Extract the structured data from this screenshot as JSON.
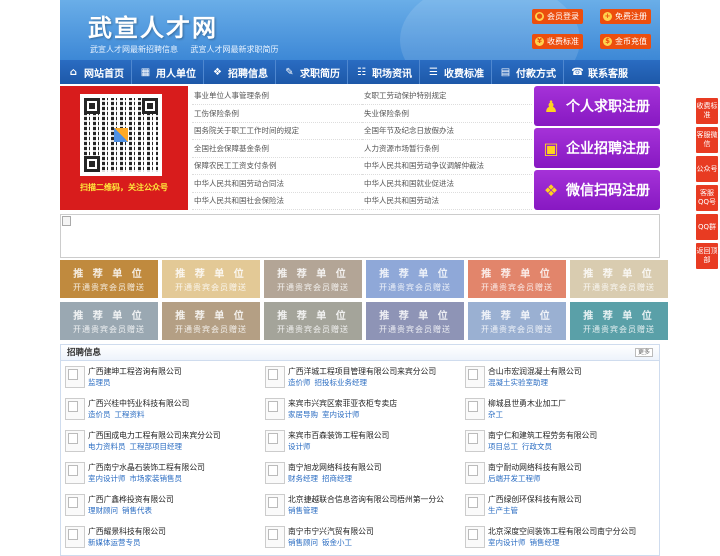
{
  "header": {
    "logo": "武宣人才网",
    "slogans": [
      "武宣人才网最新招聘信息",
      "武宣人才网最新求职简历"
    ],
    "buttons": [
      {
        "label": "会员登录",
        "icon": "user-icon"
      },
      {
        "label": "免费注册",
        "icon": "register-icon"
      },
      {
        "label": "收费标准",
        "icon": "price-icon"
      },
      {
        "label": "金币充值",
        "icon": "coin-icon"
      }
    ]
  },
  "nav": [
    {
      "label": "网站首页",
      "icon": "home-icon"
    },
    {
      "label": "用人单位",
      "icon": "building-icon"
    },
    {
      "label": "招聘信息",
      "icon": "megaphone-icon"
    },
    {
      "label": "求职简历",
      "icon": "resume-icon"
    },
    {
      "label": "职场资讯",
      "icon": "news-icon"
    },
    {
      "label": "收费标准",
      "icon": "price-icon"
    },
    {
      "label": "付款方式",
      "icon": "card-icon"
    },
    {
      "label": "联系客服",
      "icon": "phone-icon"
    }
  ],
  "qr": {
    "caption": "扫描二维码，关注公众号"
  },
  "laws": [
    [
      "事业单位人事管理条例",
      "女职工劳动保护特别规定"
    ],
    [
      "工伤保险条例",
      "失业保险条例"
    ],
    [
      "国务院关于职工工作时间的规定",
      "全国年节及纪念日放假办法"
    ],
    [
      "全国社会保障基金条例",
      "人力资源市场暂行条例"
    ],
    [
      "保障农民工工资支付条例",
      "中华人民共和国劳动争议调解仲裁法"
    ],
    [
      "中华人民共和国劳动合同法",
      "中华人民共和国就业促进法"
    ],
    [
      "中华人民共和国社会保险法",
      "中华人民共和国劳动法"
    ]
  ],
  "registers": [
    {
      "label": "个人求职注册",
      "icon": "person-icon"
    },
    {
      "label": "企业招聘注册",
      "icon": "company-icon"
    },
    {
      "label": "微信扫码注册",
      "icon": "wechat-icon"
    }
  ],
  "recommended": {
    "title": "推 荐 单 位",
    "subtitle": "开通贵宾会员赠送",
    "colors": [
      "#c08a3e",
      "#e3c996",
      "#b3a596",
      "#8fa8d8",
      "#e2856b",
      "#d9ccb0",
      "#9aa8b2",
      "#b49f84",
      "#a4a49a",
      "#8e94b6",
      "#9ab0d2",
      "#5aa0a8"
    ]
  },
  "jobs": {
    "title": "招聘信息",
    "more": "更多",
    "items": [
      {
        "company": "广西建坤工程咨询有限公司",
        "positions": [
          "监理员"
        ]
      },
      {
        "company": "广西洋城工程项目管理有限公司来宾分公司",
        "positions": [
          "造价师",
          "招投标业务经理"
        ]
      },
      {
        "company": "合山市宏润混凝土有限公司",
        "positions": [
          "混凝土实验室助理"
        ]
      },
      {
        "company": "广西兴桂中钙业科技有限公司",
        "positions": [
          "造价员",
          "工程资料"
        ]
      },
      {
        "company": "来宾市兴宾区索菲亚衣柜专卖店",
        "positions": [
          "家居导购",
          "室内设计师"
        ]
      },
      {
        "company": "柳城县世勇木业加工厂",
        "positions": [
          "杂工"
        ]
      },
      {
        "company": "广西国成电力工程有限公司来宾分公司",
        "positions": [
          "电力资料员",
          "工程部项目经理"
        ]
      },
      {
        "company": "来宾市百森装饰工程有限公司",
        "positions": [
          "设计师"
        ]
      },
      {
        "company": "南宁仁和建筑工程劳务有限公司",
        "positions": [
          "项目总工",
          "行政文员"
        ]
      },
      {
        "company": "广西南宁水晶石装饰工程有限公司",
        "positions": [
          "室内设计师",
          "市场家装销售员"
        ]
      },
      {
        "company": "南宁旭龙网络科技有限公司",
        "positions": [
          "财务经理",
          "招商经理"
        ]
      },
      {
        "company": "南宁耐动网络科技有限公司",
        "positions": [
          "后端开发工程师"
        ]
      },
      {
        "company": "广西广鑫桦投资有限公司",
        "positions": [
          "理财顾问",
          "销售代表"
        ]
      },
      {
        "company": "北京捷越联合信息咨询有限公司梧州第一分公",
        "positions": [
          "销售管理"
        ]
      },
      {
        "company": "广西绿创环保科技有限公司",
        "positions": [
          "生产主管"
        ]
      },
      {
        "company": "广西耀景科技有限公司",
        "positions": [
          "新媒体运营专员"
        ]
      },
      {
        "company": "南宁市宁兴汽贸有限公司",
        "positions": [
          "销售顾问",
          "钣金小工"
        ]
      },
      {
        "company": "北京深度空间装饰工程有限公司南宁分公司",
        "positions": [
          "室内设计师",
          "销售经理"
        ]
      }
    ]
  },
  "float": [
    "收费标准",
    "客服微信",
    "公众号",
    "客服QQ号",
    "QQ群",
    "返回顶部"
  ]
}
